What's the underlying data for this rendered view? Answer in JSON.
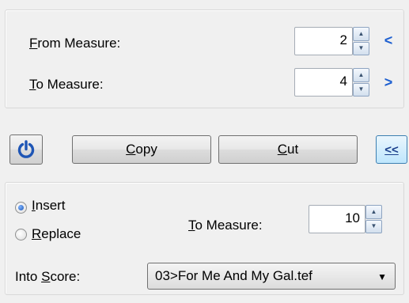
{
  "range": {
    "from_label_accel": "F",
    "from_label_rest": "rom Measure:",
    "from_value": "2",
    "from_chevron": "<",
    "to_label_accel": "T",
    "to_label_rest": "o Measure:",
    "to_value": "4",
    "to_chevron": ">"
  },
  "actions": {
    "copy_accel": "C",
    "copy_rest": "opy",
    "cut_accel": "C",
    "cut_rest": "ut",
    "collapse_label": "<<"
  },
  "paste": {
    "insert_accel": "I",
    "insert_rest": "nsert",
    "insert_checked": true,
    "replace_accel": "R",
    "replace_rest": "eplace",
    "replace_checked": false,
    "to_measure_accel": "T",
    "to_measure_rest": "o Measure:",
    "to_measure_value": "10",
    "into_score_prefix": "Into ",
    "into_score_accel": "S",
    "into_score_rest": "core:",
    "score_selected": "03>For Me And My Gal.tef"
  },
  "icons": {
    "power": "power-icon",
    "spin_up": "spin-up-icon",
    "spin_down": "spin-down-icon",
    "dropdown": "dropdown-arrow-icon"
  },
  "colors": {
    "accent": "#1d5fd0",
    "power_icon": "#1f56b5",
    "collapse_bg": "#bee6fd"
  }
}
